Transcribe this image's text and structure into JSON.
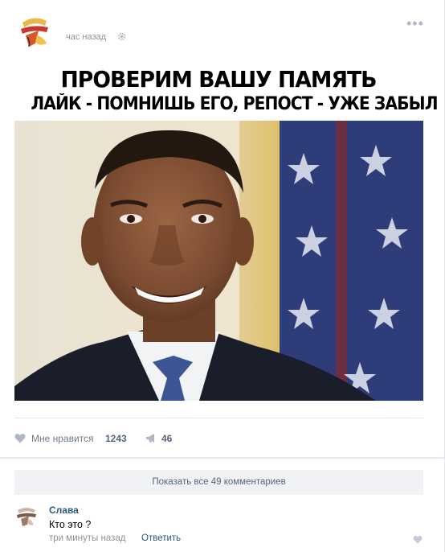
{
  "post": {
    "time": "час назад",
    "more_glyph": "•••",
    "headline_line1": "ПРОВЕРИМ ВАШУ ПАМЯТЬ",
    "headline_line2": "ЛАЙК - ПОМНИШЬ ЕГО, РЕПОСТ - УЖЕ ЗАБЫЛ",
    "likes_label": "Мне нравится",
    "likes_count": "1243",
    "shares_count": "46",
    "icons": [
      "gear-icon",
      "more-icon",
      "heart-icon",
      "megaphone-icon"
    ]
  },
  "comments": {
    "show_all_label": "Показать все 49 комментариев",
    "items": [
      {
        "author": "Слава",
        "text": "Кто это ?",
        "time": "три минуты назад",
        "reply_label": "Ответить"
      }
    ]
  },
  "colors": {
    "link": "#2a5885",
    "muted": "#939393",
    "action_blue": "#55677d",
    "icon_gray": "#aeb7c2",
    "page_bg": "#edeef0"
  }
}
